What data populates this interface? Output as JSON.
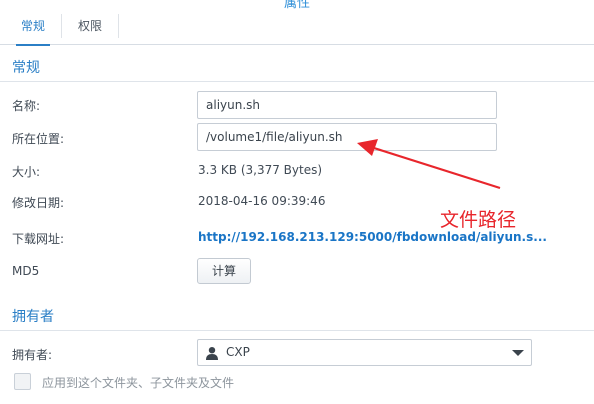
{
  "window": {
    "title": "属性"
  },
  "tabs": [
    {
      "label": "常规",
      "active": true
    },
    {
      "label": "权限",
      "active": false
    }
  ],
  "sections": {
    "general": "常规",
    "owner": "拥有者"
  },
  "fields": {
    "name": {
      "label": "名称:",
      "value": "aliyun.sh"
    },
    "location": {
      "label": "所在位置:",
      "value": "/volume1/file/aliyun.sh"
    },
    "size": {
      "label": "大小:",
      "value": "3.3 KB (3,377 Bytes)"
    },
    "modified": {
      "label": "修改日期:",
      "value": "2018-04-16 09:39:46"
    },
    "download": {
      "label": "下载网址:",
      "value": "http://192.168.213.129:5000/fbdownload/aliyun.s..."
    },
    "md5": {
      "label": "MD5",
      "button": "计算"
    }
  },
  "owner": {
    "label": "拥有者:",
    "selected": "CXP",
    "icon": "user-icon"
  },
  "apply_checkbox": {
    "label": "应用到这个文件夹、子文件夹及文件",
    "checked": false
  },
  "annotation": {
    "text": "文件路径",
    "color": "#e8262c"
  },
  "colors": {
    "accent": "#2b7fc6",
    "link": "#1a75c6"
  }
}
